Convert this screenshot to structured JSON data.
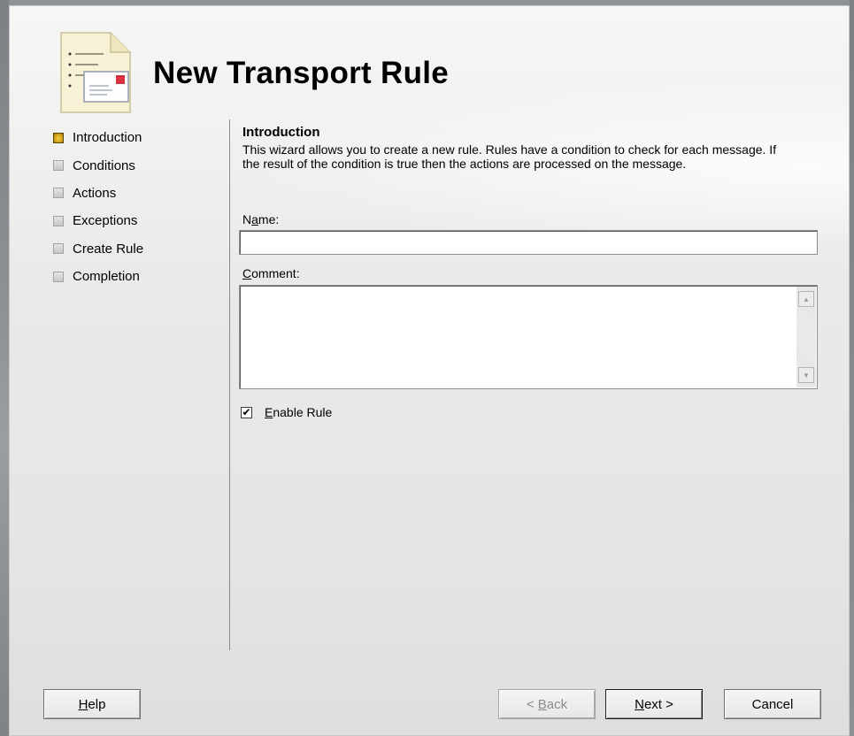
{
  "window": {
    "title": "New Transport Rule"
  },
  "steps": [
    {
      "label": "Introduction",
      "state": "current"
    },
    {
      "label": "Conditions",
      "state": "pending"
    },
    {
      "label": "Actions",
      "state": "pending"
    },
    {
      "label": "Exceptions",
      "state": "pending"
    },
    {
      "label": "Create Rule",
      "state": "pending"
    },
    {
      "label": "Completion",
      "state": "pending"
    }
  ],
  "content": {
    "heading": "Introduction",
    "description": "This wizard allows you to create a new rule. Rules have a condition to check for each message. If the result of the condition is true then the actions are processed on the message.",
    "name_label": {
      "pre": "N",
      "accel": "a",
      "post": "me:"
    },
    "name_value": "",
    "comment_label": {
      "accel": "C",
      "post": "omment:"
    },
    "comment_value": "",
    "enable_rule": {
      "accel": "E",
      "post": "nable Rule",
      "checked": true,
      "check_glyph": "✔"
    },
    "scroll_up_glyph": "▲",
    "scroll_down_glyph": "▼"
  },
  "buttons": {
    "help": {
      "accel": "H",
      "post": "elp"
    },
    "back": {
      "pre": "< ",
      "accel": "B",
      "post": "ack",
      "enabled": false
    },
    "next": {
      "accel": "N",
      "post": "ext >",
      "default": true
    },
    "cancel": {
      "label": "Cancel"
    }
  },
  "colors": {
    "active_step": "#d9a71b",
    "pending_step": "#c6c6c6",
    "disabled_text": "#8a8a8a"
  }
}
